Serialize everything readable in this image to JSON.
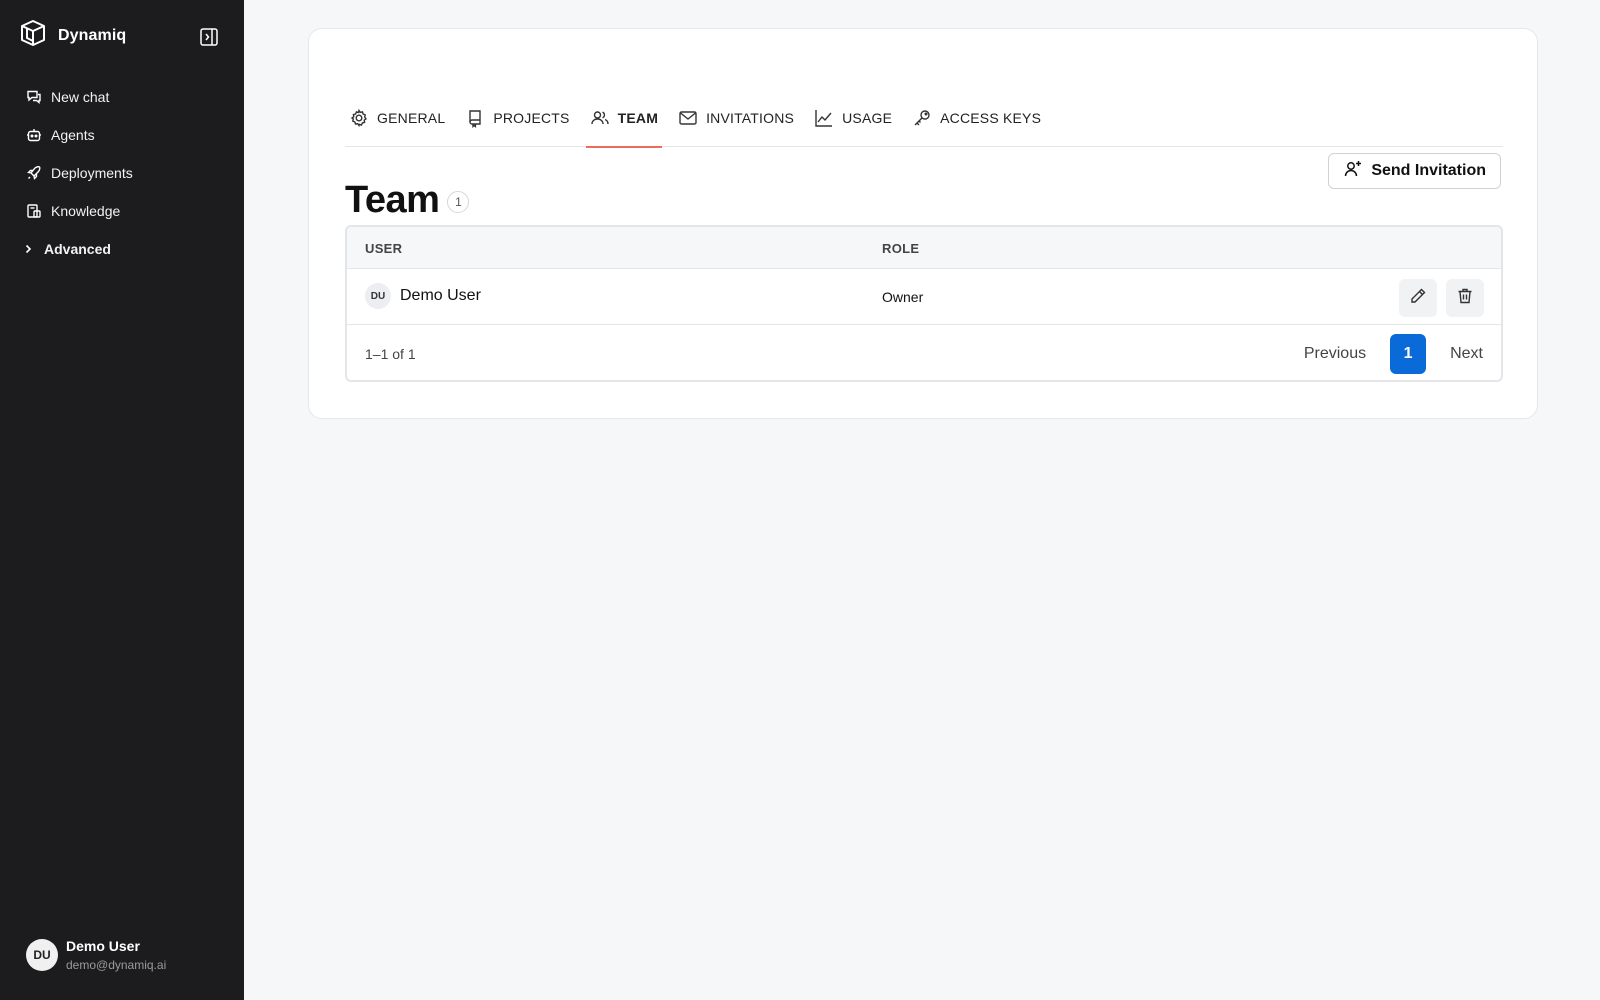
{
  "app": {
    "name": "Dynamiq"
  },
  "sidebar": {
    "items": [
      {
        "label": "New chat",
        "icon": "chat-icon"
      },
      {
        "label": "Agents",
        "icon": "robot-icon"
      },
      {
        "label": "Deployments",
        "icon": "rocket-icon"
      },
      {
        "label": "Knowledge",
        "icon": "book-icon"
      }
    ],
    "advanced_label": "Advanced",
    "user": {
      "initials": "DU",
      "name": "Demo User",
      "email": "demo@dynamiq.ai"
    }
  },
  "tabs": [
    {
      "label": "GENERAL",
      "icon": "gear-icon",
      "active": false
    },
    {
      "label": "PROJECTS",
      "icon": "bookmark-icon",
      "active": false
    },
    {
      "label": "TEAM",
      "icon": "users-icon",
      "active": true
    },
    {
      "label": "INVITATIONS",
      "icon": "mail-icon",
      "active": false
    },
    {
      "label": "USAGE",
      "icon": "chart-line-icon",
      "active": false
    },
    {
      "label": "ACCESS KEYS",
      "icon": "key-icon",
      "active": false
    }
  ],
  "page": {
    "title": "Team",
    "count": "1",
    "invite_label": "Send Invitation"
  },
  "table": {
    "columns": [
      "USER",
      "ROLE"
    ],
    "rows": [
      {
        "initials": "DU",
        "name": "Demo User",
        "role": "Owner"
      }
    ],
    "range_text": "1–1 of 1",
    "previous_label": "Previous",
    "current_page": "1",
    "next_label": "Next"
  },
  "colors": {
    "accent": "#0a6ad8",
    "tab_underline": "#f06a5c",
    "sidebar_bg": "#1c1c1e"
  }
}
